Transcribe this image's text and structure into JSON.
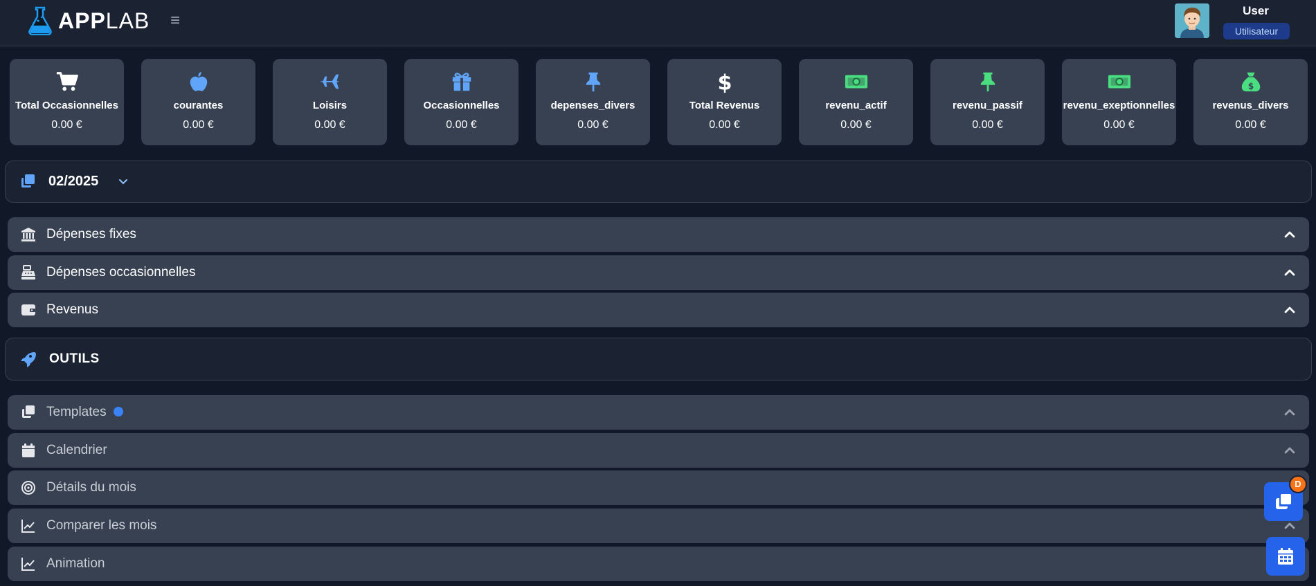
{
  "header": {
    "logo_bold": "APP",
    "logo_light": "LAB",
    "menu_icon": "hamburger-icon",
    "user_name": "User",
    "user_role": "Utilisateur"
  },
  "stats": [
    {
      "label": "Total Occasionnelles",
      "value": "0.00 €",
      "icon": "cart-icon",
      "color": "#ffffff"
    },
    {
      "label": "courantes",
      "value": "0.00 €",
      "icon": "apple-icon",
      "color": "#60a5fa"
    },
    {
      "label": "Loisirs",
      "value": "0.00 €",
      "icon": "plane-icon",
      "color": "#60a5fa"
    },
    {
      "label": "Occasionnelles",
      "value": "0.00 €",
      "icon": "gift-icon",
      "color": "#60a5fa"
    },
    {
      "label": "depenses_divers",
      "value": "0.00 €",
      "icon": "pin-icon",
      "color": "#60a5fa"
    },
    {
      "label": "Total Revenus",
      "value": "0.00 €",
      "icon": "dollar-icon",
      "color": "#ffffff"
    },
    {
      "label": "revenu_actif",
      "value": "0.00 €",
      "icon": "money-bill-icon",
      "color": "#4ade80"
    },
    {
      "label": "revenu_passif",
      "value": "0.00 €",
      "icon": "pin-icon",
      "color": "#4ade80"
    },
    {
      "label": "revenu_exeptionnelles",
      "value": "0.00 €",
      "icon": "money-bill-icon",
      "color": "#4ade80"
    },
    {
      "label": "revenus_divers",
      "value": "0.00 €",
      "icon": "money-bag-icon",
      "color": "#4ade80"
    }
  ],
  "month": {
    "label": "02/2025",
    "icon": "copy-icon"
  },
  "sections": [
    {
      "title": "Dépenses fixes",
      "icon": "bank-icon"
    },
    {
      "title": "Dépenses occasionnelles",
      "icon": "cash-register-icon"
    },
    {
      "title": "Revenus",
      "icon": "wallet-icon"
    }
  ],
  "tools": {
    "label": "OUTILS",
    "icon": "rocket-icon",
    "items": [
      {
        "title": "Templates",
        "icon": "copy-icon",
        "indicator": true
      },
      {
        "title": "Calendrier",
        "icon": "calendar-icon"
      },
      {
        "title": "Détails du mois",
        "icon": "target-icon"
      },
      {
        "title": "Comparer les mois",
        "icon": "chart-line-icon"
      },
      {
        "title": "Animation",
        "icon": "chart-line-icon"
      }
    ]
  },
  "fab": {
    "badge": "D"
  },
  "colors": {
    "accent": "#2563eb",
    "badge": "#f97316",
    "card": "#374151",
    "background": "#111827"
  }
}
